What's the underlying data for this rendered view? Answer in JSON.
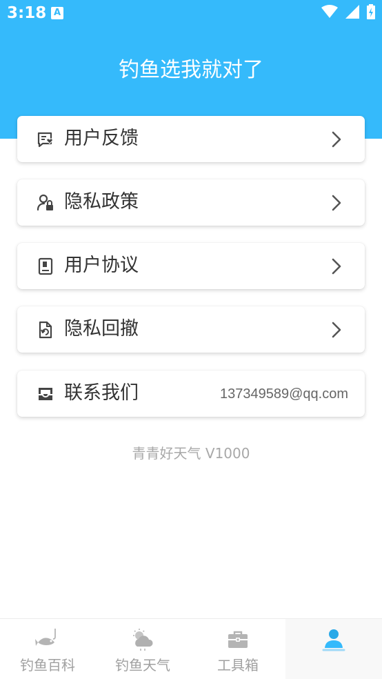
{
  "status_bar": {
    "time": "3:18",
    "notification_badge": "A",
    "icons": [
      "wifi-icon",
      "signal-icon",
      "battery-charging-icon"
    ]
  },
  "header": {
    "title": "钓鱼选我就对了",
    "background_color": "#35bafb"
  },
  "menu": [
    {
      "label": "用户反馈",
      "icon": "feedback-icon",
      "action": "chevron-right-icon"
    },
    {
      "label": "隐私政策",
      "icon": "user-lock-icon",
      "action": "chevron-right-icon"
    },
    {
      "label": "用户协议",
      "icon": "agreement-book-icon",
      "action": "chevron-right-icon"
    },
    {
      "label": "隐私回撤",
      "icon": "document-revoke-icon",
      "action": "chevron-right-icon"
    }
  ],
  "contact": {
    "label": "联系我们",
    "icon": "inbox-icon",
    "email": "137349589@qq.com"
  },
  "version_text": "青青好天气 V1000",
  "bottom_nav": {
    "items": [
      {
        "label": "钓鱼百科",
        "icon": "fishing-icon",
        "active": false
      },
      {
        "label": "钓鱼天气",
        "icon": "weather-icon",
        "active": false
      },
      {
        "label": "工具箱",
        "icon": "toolbox-icon",
        "active": false
      },
      {
        "label": "",
        "icon": "profile-icon",
        "active": true
      }
    ],
    "active_color": "#35bafb",
    "inactive_color": "#a0a0a0"
  }
}
